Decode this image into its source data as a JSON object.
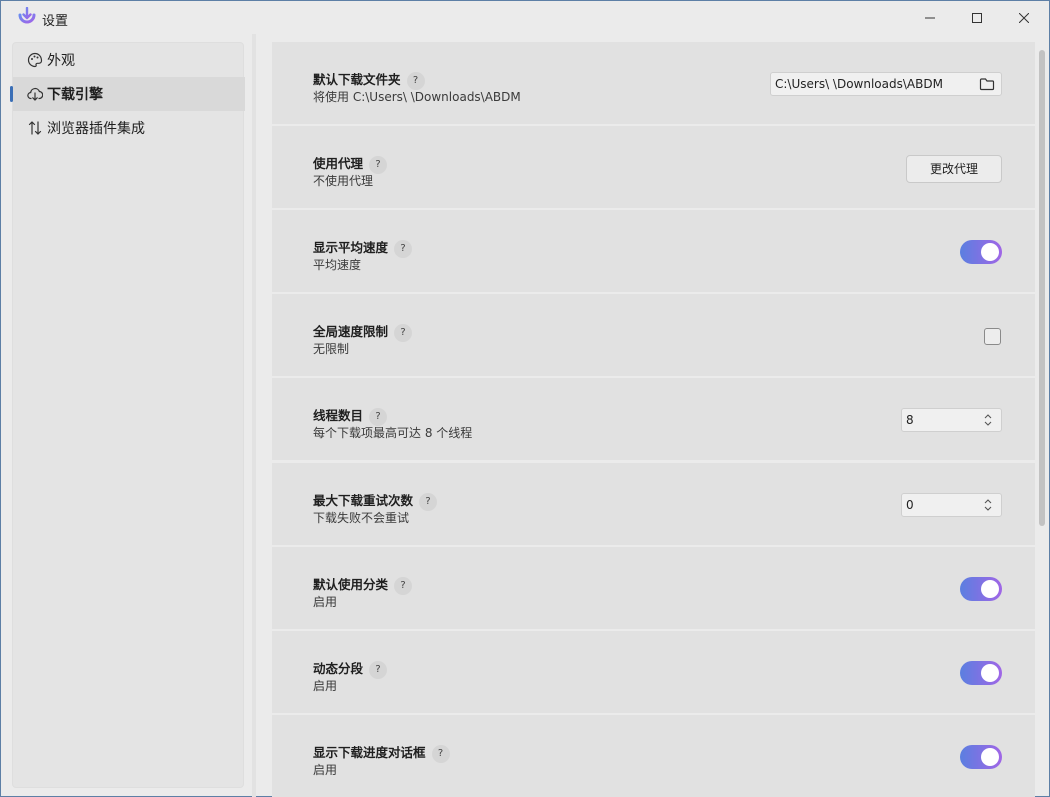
{
  "window": {
    "title": "设置",
    "minimize_glyph": "—",
    "maximize_glyph": "☐",
    "close_glyph": "✕"
  },
  "sidebar": {
    "items": [
      {
        "label": "外观",
        "icon": "palette-icon"
      },
      {
        "label": "下载引擎",
        "icon": "cloud-download-icon",
        "active": true
      },
      {
        "label": "浏览器插件集成",
        "icon": "arrows-updown-icon"
      }
    ]
  },
  "settings": [
    {
      "title": "默认下载文件夹",
      "desc": "将使用 C:\\Users\\     \\Downloads\\ABDM",
      "control": "path",
      "value": "C:\\Users\\     \\Downloads\\ABDM"
    },
    {
      "title": "使用代理",
      "desc": "不使用代理",
      "control": "button",
      "button_label": "更改代理"
    },
    {
      "title": "显示平均速度",
      "desc": "平均速度",
      "control": "toggle",
      "on": true
    },
    {
      "title": "全局速度限制",
      "desc": "无限制",
      "control": "checkbox",
      "checked": false
    },
    {
      "title": "线程数目",
      "desc": "每个下载项最高可达 8 个线程",
      "control": "spinner",
      "value": "8"
    },
    {
      "title": "最大下载重试次数",
      "desc": "下载失败不会重试",
      "control": "spinner",
      "value": "0"
    },
    {
      "title": "默认使用分类",
      "desc": "启用",
      "control": "toggle",
      "on": true
    },
    {
      "title": "动态分段",
      "desc": "启用",
      "control": "toggle",
      "on": true
    },
    {
      "title": "显示下载进度对话框",
      "desc": "启用",
      "control": "toggle",
      "on": true
    }
  ],
  "help_glyph": "?",
  "colors": {
    "toggle_start": "#5b7fe0",
    "toggle_end": "#a066e6",
    "accent_bar": "#3b6fb6"
  }
}
